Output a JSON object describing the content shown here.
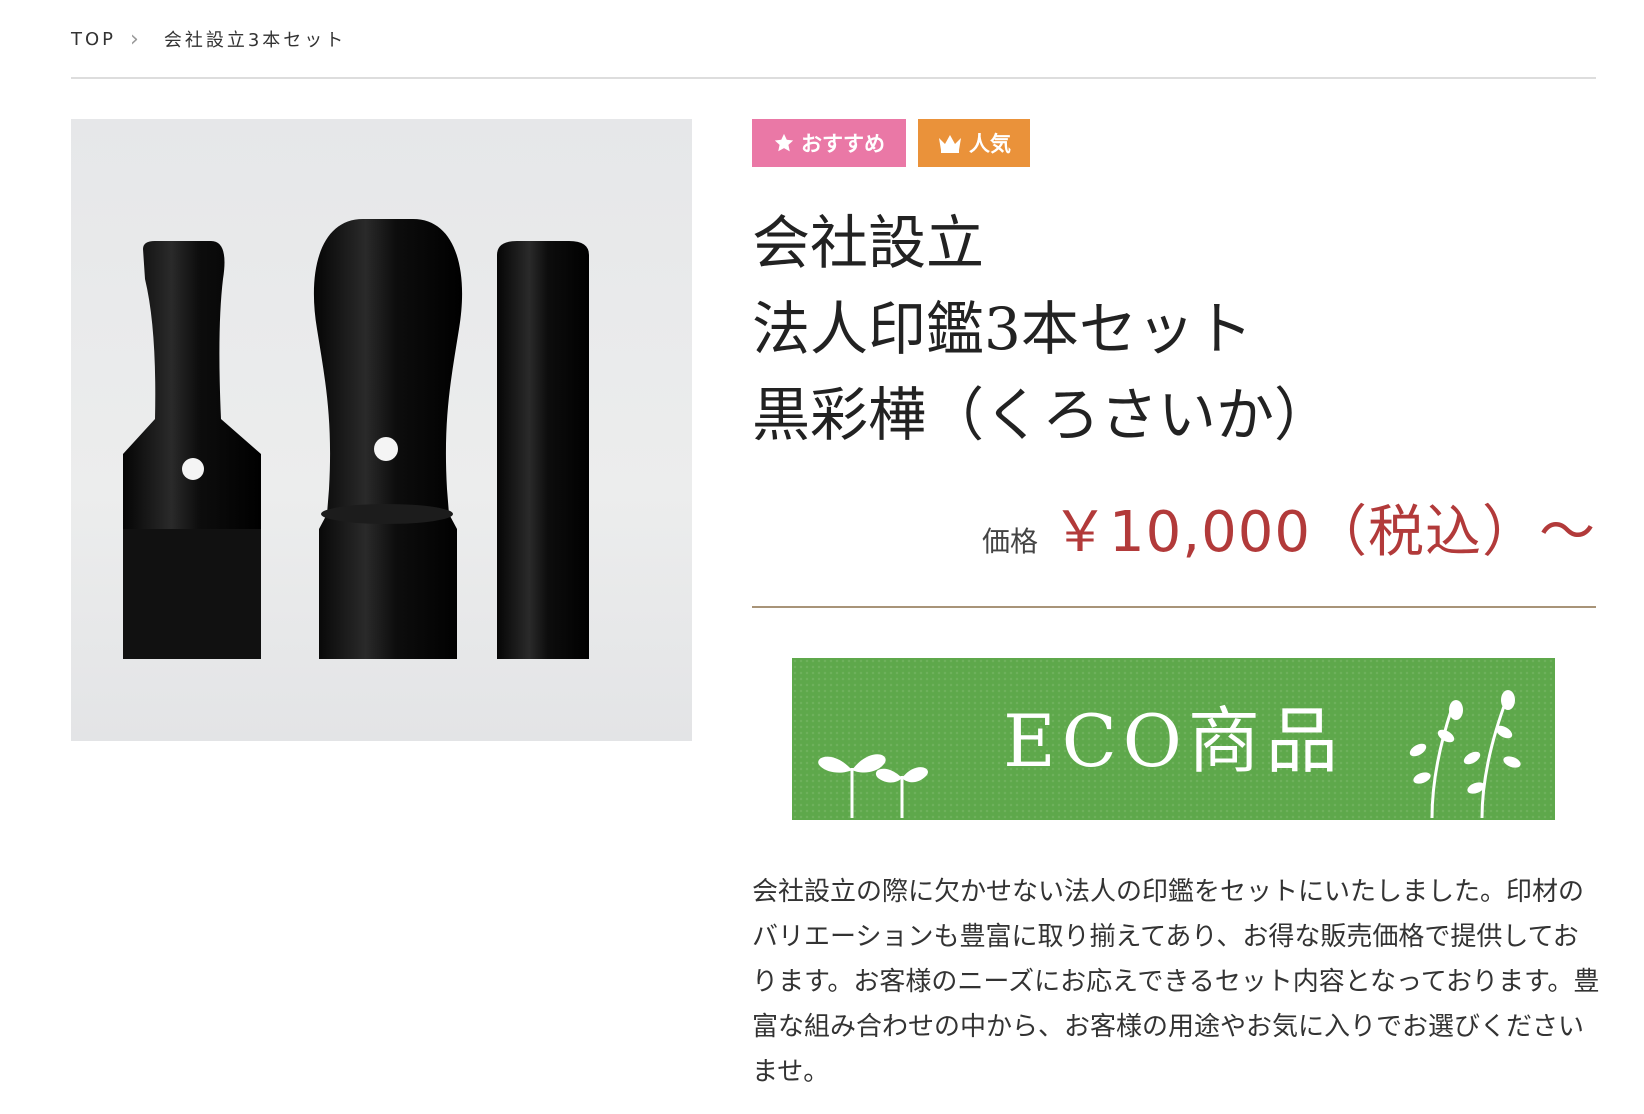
{
  "breadcrumb": {
    "home": "TOP",
    "current": "会社設立3本セット"
  },
  "badges": {
    "recommend": "おすすめ",
    "popular": "人気"
  },
  "product": {
    "title_line1": "会社設立",
    "title_line2": "法人印鑑3本セット",
    "title_line3": "黒彩樺（くろさいか）",
    "price_label": "価格",
    "price_value": "￥10,000（税込）〜",
    "image_alt": "黒彩樺 法人印鑑3本セット"
  },
  "eco_banner": {
    "text": "ECO商品"
  },
  "description": "会社設立の際に欠かせない法人の印鑑をセットにいたしました。印材のバリエーションも豊富に取り揃えてあり、お得な販売価格で提供しております。お客様のニーズにお応えできるセット内容となっております。豊富な組み合わせの中から、お客様の用途やお気に入りでお選びくださいませ。",
  "colors": {
    "badge_recommend": "#ea78a6",
    "badge_popular": "#ea923a",
    "price": "#b23a3a",
    "eco_green": "#5ea84b",
    "divider": "#a89478"
  },
  "icons": {
    "recommend": "star-icon",
    "popular": "crown-icon",
    "breadcrumb_separator": "chevron-right-icon"
  }
}
